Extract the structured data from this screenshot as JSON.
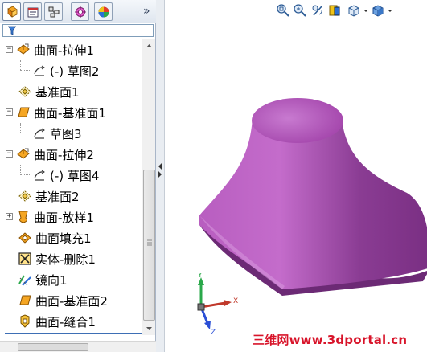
{
  "panel": {
    "tabs": [
      {
        "icon": "feature-manager-icon",
        "active": true
      },
      {
        "icon": "property-manager-icon",
        "active": false
      },
      {
        "icon": "configuration-manager-icon",
        "active": false
      },
      {
        "icon": "dimxpert-manager-icon",
        "active": false
      },
      {
        "icon": "display-manager-icon",
        "active": false
      }
    ],
    "overflow_label": "»",
    "tree": [
      {
        "label": "曲面-拉伸1",
        "icon": "surface-extrude-icon",
        "expander": "−"
      },
      {
        "label": "(-) 草图2",
        "icon": "sketch-icon"
      },
      {
        "label": "基准面1",
        "icon": "plane-icon"
      },
      {
        "label": "曲面-基准面1",
        "icon": "planar-surface-icon",
        "expander": "−"
      },
      {
        "label": "草图3",
        "icon": "sketch-icon"
      },
      {
        "label": "曲面-拉伸2",
        "icon": "surface-extrude-icon",
        "expander": "−"
      },
      {
        "label": "(-) 草图4",
        "icon": "sketch-icon"
      },
      {
        "label": "基准面2",
        "icon": "plane-icon"
      },
      {
        "label": "曲面-放样1",
        "icon": "surface-loft-icon",
        "expander": "+"
      },
      {
        "label": "曲面填充1",
        "icon": "surface-fill-icon"
      },
      {
        "label": "实体-删除1",
        "icon": "delete-body-icon"
      },
      {
        "label": "镜向1",
        "icon": "mirror-icon"
      },
      {
        "label": "曲面-基准面2",
        "icon": "planar-surface-icon"
      },
      {
        "label": "曲面-缝合1",
        "icon": "knit-surface-icon"
      }
    ]
  },
  "viewport": {
    "toolbar": [
      "zoom-to-fit-icon",
      "zoom-to-area-icon",
      "previous-view-icon",
      "section-view-icon",
      "view-orientation-icon",
      "display-style-icon"
    ],
    "triad": {
      "x": "X",
      "y": "Y",
      "z": "Z"
    },
    "model_color": "#a040a8"
  },
  "watermark": "三维网www.3dportal.cn"
}
